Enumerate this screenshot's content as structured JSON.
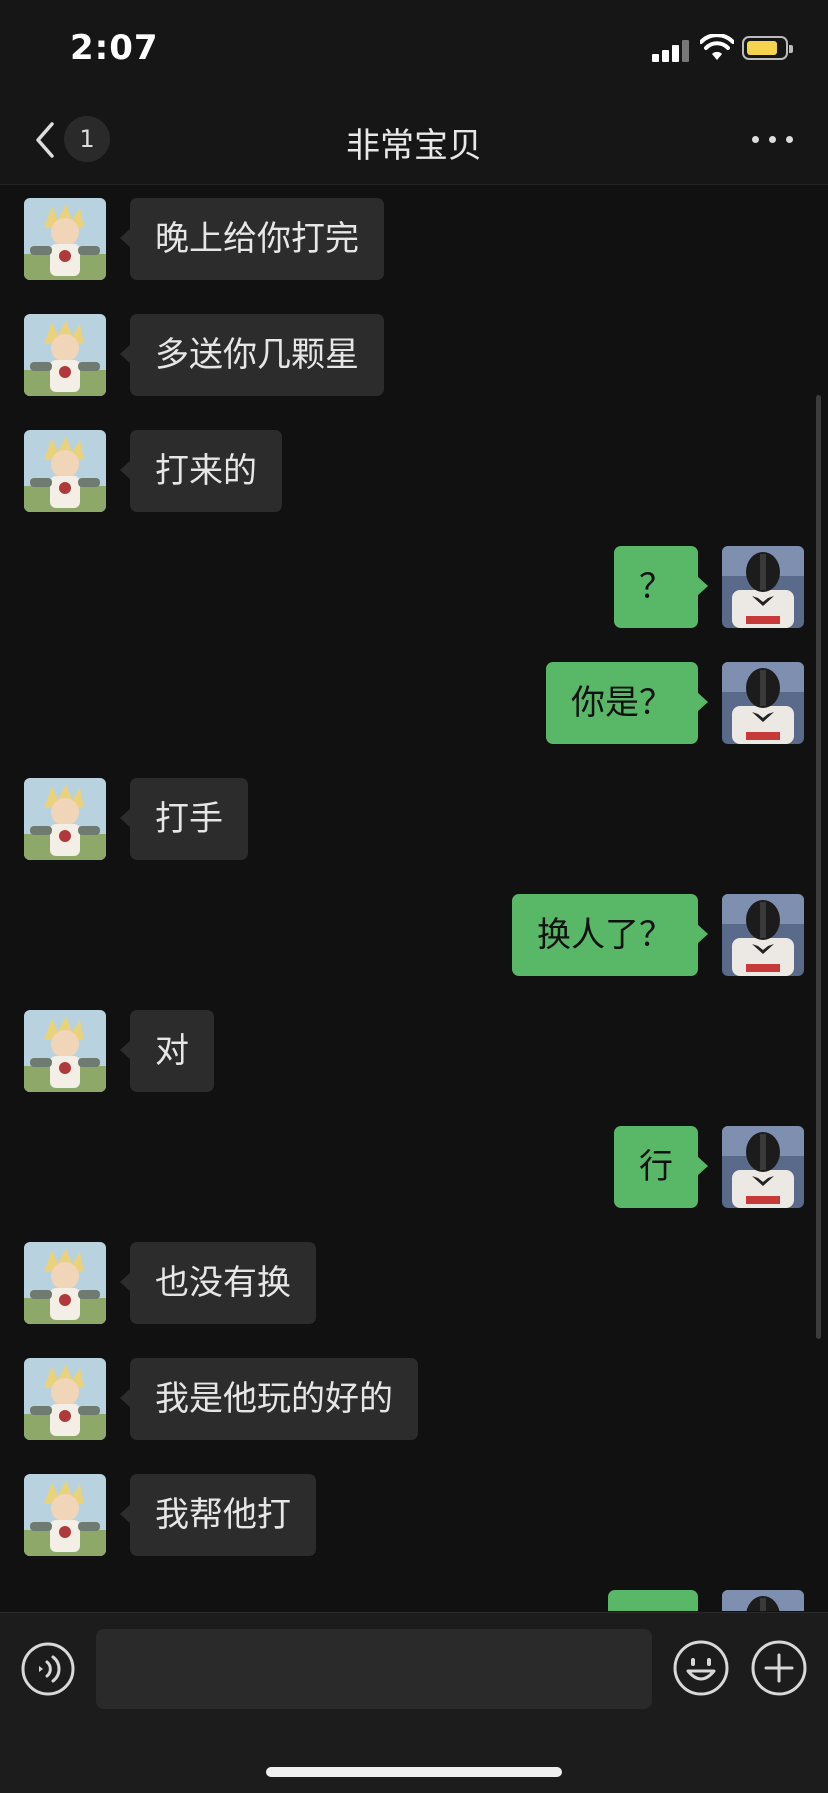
{
  "status_bar": {
    "time": "2:07",
    "battery_color": "#f5d34e"
  },
  "nav": {
    "unread_count": "1",
    "title": "非常宝贝"
  },
  "icons": {
    "back": "chevron-left-icon",
    "more": "more-horizontal-icon",
    "voice": "voice-icon",
    "emoji": "emoji-icon",
    "plus": "plus-icon"
  },
  "colors": {
    "outgoing_bubble": "#58b868",
    "incoming_bubble": "#2c2c2c",
    "background": "#111111"
  },
  "messages": [
    {
      "side": "left",
      "text": "晚上给你打完"
    },
    {
      "side": "left",
      "text": "多送你几颗星"
    },
    {
      "side": "left",
      "text": "打来的"
    },
    {
      "side": "right",
      "text": "？"
    },
    {
      "side": "right",
      "text": "你是？"
    },
    {
      "side": "left",
      "text": "打手"
    },
    {
      "side": "right",
      "text": "换人了？"
    },
    {
      "side": "left",
      "text": "对"
    },
    {
      "side": "right",
      "text": "行"
    },
    {
      "side": "left",
      "text": "也没有换"
    },
    {
      "side": "left",
      "text": "我是他玩的好的"
    },
    {
      "side": "left",
      "text": "我帮他打"
    },
    {
      "side": "right",
      "text": ""
    }
  ]
}
